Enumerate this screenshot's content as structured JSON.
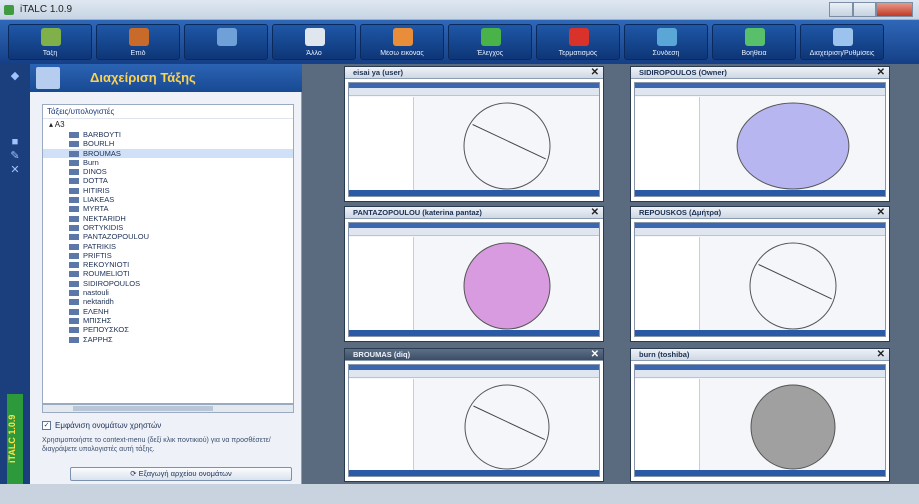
{
  "window": {
    "title": "iTALC 1.0.9"
  },
  "toolbar": {
    "buttons": [
      {
        "label": "Τάξη",
        "icon": "classroom-icon",
        "color": "#7fb04a"
      },
      {
        "label": "Επιδ",
        "icon": "demo-icon",
        "color": "#c86b2a"
      },
      {
        "label": "",
        "icon": "monitor-icon",
        "color": "#6fa0d8"
      },
      {
        "label": "Άλλο",
        "icon": "lock-icon",
        "color": "#e0e6ee"
      },
      {
        "label": "Μέσω εικόνας",
        "icon": "user-icon",
        "color": "#e88d3a"
      },
      {
        "label": "Έλεγχος",
        "icon": "power-on-icon",
        "color": "#49b34a"
      },
      {
        "label": "Τερματισμός",
        "icon": "power-off-icon",
        "color": "#d8322a"
      },
      {
        "label": "Σύνδεση",
        "icon": "logon-icon",
        "color": "#5aa6d6"
      },
      {
        "label": "Βοήθεια",
        "icon": "help-icon",
        "color": "#58c06a"
      },
      {
        "label": "Διαχείριση/Ρυθμίσεις",
        "icon": "settings-icon",
        "color": "#9cc3ee"
      }
    ]
  },
  "panel": {
    "title": "Διαχείριση Τάξης",
    "tree_header": "Τάξεις/υπολογιστές",
    "root": "A3",
    "items": [
      "BARBOYTI",
      "BOURLH",
      "BROUMAS",
      "Burn",
      "DINOS",
      "DOTTA",
      "HITIRIS",
      "LIAKEAS",
      "MYRTA",
      "NEKTARIDH",
      "ORTYKIDIS",
      "PANTAZOPOULOU",
      "PATRIKIS",
      "PRIFTIS",
      "REKOYNIOTI",
      "ROUMELIOTI",
      "SIDIROPOULOS",
      "nastouli",
      "nektaridh",
      "ΕΛΕΝΗ",
      "ΜΠΙΣΗΣ",
      "ΡΕΠΟΥΣΚΟΣ",
      "ΣΑΡΡΗΣ"
    ],
    "selected_index": 2,
    "checkbox_label": "Εμφάνιση ονομάτων χρηστών",
    "hint": "Χρησιμοποιήστε το context-menu (δεξί κλικ ποντικιού) για να προσθέσετε/διαγράψετε υπολογιστές αυτή τάξης.",
    "refresh_label": "Εξαγωγή αρχείου ονομάτων"
  },
  "tiles": [
    {
      "title": "eisai ya (user)",
      "shape": "circle-line",
      "fill": "none"
    },
    {
      "title": "SIDIROPOULOS (Owner)",
      "shape": "ellipse",
      "fill": "#b8b6f0"
    },
    {
      "title": "PANTAZOPOULOU (katerina pantaz)",
      "shape": "circle",
      "fill": "#d99be0"
    },
    {
      "title": "REPOUSKOS (Δμήτρα)",
      "shape": "circle-line",
      "fill": "none"
    },
    {
      "title": "BROUMAS (diq)",
      "shape": "circle-line",
      "fill": "none"
    },
    {
      "title": "burn (toshiba)",
      "shape": "circle",
      "fill": "#a0a0a0"
    }
  ]
}
